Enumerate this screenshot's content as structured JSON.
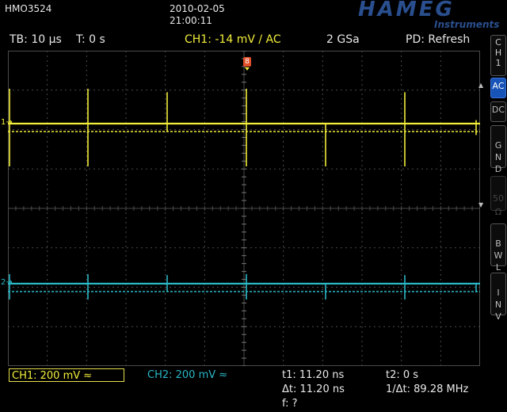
{
  "header": {
    "model": "HMO3524",
    "date": "2010-02-05",
    "time": "21:00:11",
    "logo": "HAMEG",
    "logo_sub": "Instruments"
  },
  "status_bar": {
    "timebase": "TB: 10 µs",
    "trigger_time": "T: 0 s",
    "trigger_info": "CH1: -14 mV / AC",
    "sample_rate": "2 GSa",
    "mode": "PD: Refresh"
  },
  "side_menu": {
    "channel_tab": [
      "C",
      "H",
      "1"
    ],
    "buttons": [
      {
        "label": "AC",
        "state": "active"
      },
      {
        "label": "DC",
        "state": "normal"
      },
      {
        "label": "G\nN\nD",
        "state": "normal"
      },
      {
        "label": "50\nΩ",
        "state": "dim"
      },
      {
        "label": "B\nW\nL",
        "state": "normal"
      },
      {
        "label": "I\nN\nV",
        "state": "normal"
      }
    ]
  },
  "markers": {
    "trigger_marker": "8",
    "ch1_marker": "1",
    "ch2_marker": "2"
  },
  "traces": {
    "ch1_color": "#f2ee3a",
    "ch2_color": "#2ab7c6",
    "grid_color": "#4a4a4a"
  },
  "bottom_bar": {
    "ch1_scale": "CH1: 200 mV ≈",
    "ch2_scale": "CH2: 200 mV ≈",
    "t1": "t1: 11.20 ns",
    "t2": "t2: 0 s",
    "delta_t": "Δt: 11.20 ns",
    "inv_delta_t": "1/Δt: 89.28 MHz",
    "freq": "f: ?"
  }
}
